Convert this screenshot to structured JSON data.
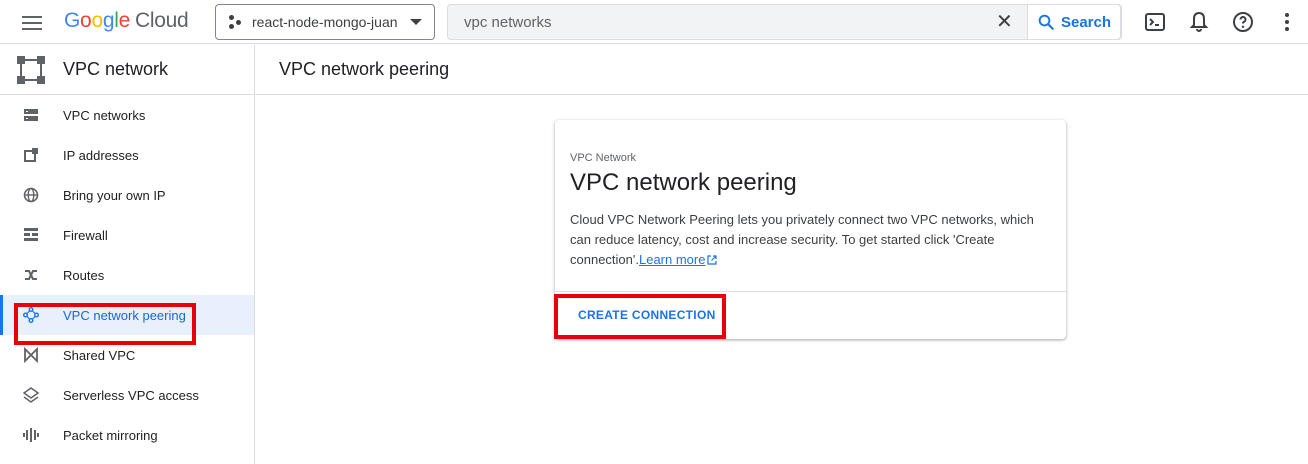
{
  "topbar": {
    "menu_icon": "hamburger-menu-icon",
    "logo_letters": [
      "G",
      "o",
      "o",
      "g",
      "l",
      "e"
    ],
    "logo_product": "Cloud",
    "project": "react-node-mongo-juan",
    "search_value": "vpc networks",
    "search_button": "Search",
    "icons": [
      "cloud-shell-icon",
      "notifications-icon",
      "help-icon",
      "more-vert-icon"
    ]
  },
  "sidebar": {
    "product": "VPC network",
    "items": [
      {
        "label": "VPC networks",
        "icon": "vpc-networks-icon"
      },
      {
        "label": "IP addresses",
        "icon": "ip-addresses-icon"
      },
      {
        "label": "Bring your own IP",
        "icon": "globe-icon"
      },
      {
        "label": "Firewall",
        "icon": "firewall-icon"
      },
      {
        "label": "Routes",
        "icon": "routes-icon"
      },
      {
        "label": "VPC network peering",
        "icon": "peering-icon",
        "active": true
      },
      {
        "label": "Shared VPC",
        "icon": "shared-vpc-icon"
      },
      {
        "label": "Serverless VPC access",
        "icon": "serverless-icon"
      },
      {
        "label": "Packet mirroring",
        "icon": "packet-mirroring-icon"
      }
    ]
  },
  "main": {
    "page_title": "VPC network peering",
    "card": {
      "eyebrow": "VPC Network",
      "title": "VPC network peering",
      "description": "Cloud VPC Network Peering lets you privately connect two VPC networks, which can reduce latency, cost and increase security. To get started click 'Create connection'.",
      "learn_more": "Learn more",
      "button": "CREATE CONNECTION"
    }
  },
  "colors": {
    "accent": "#1a73e8",
    "active_bg": "#e8f0fe",
    "highlight": "#e8000b"
  }
}
